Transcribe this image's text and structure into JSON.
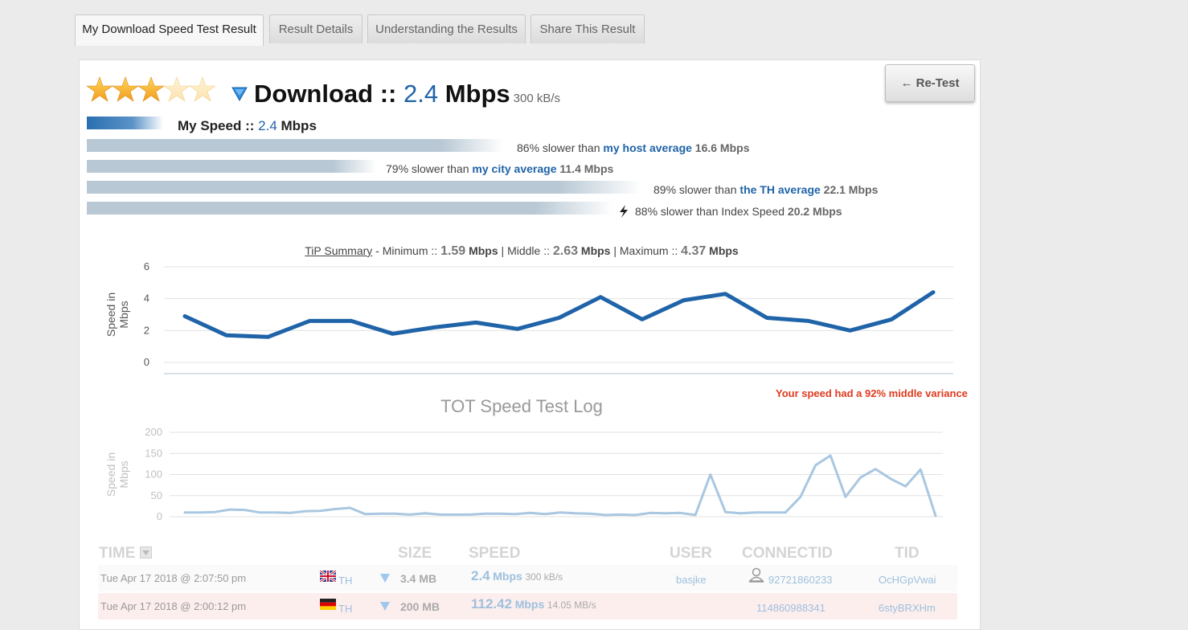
{
  "tabs": [
    {
      "label": "My Download Speed Test Result",
      "active": true
    },
    {
      "label": "Result Details"
    },
    {
      "label": "Understanding the Results"
    },
    {
      "label": "Share This Result"
    }
  ],
  "rating": {
    "stars": 3,
    "max": 5
  },
  "header": {
    "title": "Download ::",
    "speed": "2.4",
    "unit": "Mbps",
    "kbs": "300 kB/s",
    "retest_label": "← Re-Test"
  },
  "comparison": {
    "my_speed": {
      "prefix": "My Speed ::",
      "value": "2.4",
      "unit": "Mbps"
    },
    "rows": [
      {
        "pct_text": "86% slower than",
        "link": "my host average",
        "value": "16.6 Mbps",
        "fill": 0.86
      },
      {
        "pct_text": "79% slower than",
        "link": "my city average",
        "value": "11.4 Mbps",
        "fill": 0.79
      },
      {
        "pct_text": "89% slower than",
        "link": "the TH average",
        "value": "22.1 Mbps",
        "fill": 0.89
      },
      {
        "pct_text": "88% slower than Index Speed",
        "link": "",
        "value": "20.2 Mbps",
        "fill": 0.88
      }
    ]
  },
  "summary": {
    "tip": "TiP Summary",
    "minimum_label": "- Minimum ::",
    "minimum": "1.59",
    "middle_label": "| Middle ::",
    "middle": "2.63",
    "maximum_label": "| Maximum ::",
    "maximum": "4.37",
    "unit": "Mbps"
  },
  "variance_text": "Your speed had a 92% middle variance",
  "log_title": "TOT Speed Test Log",
  "chart_data": [
    {
      "type": "line",
      "ylabel": "Speed in Mbps",
      "ylim": [
        0,
        6
      ],
      "yticks": [
        0,
        2,
        4,
        6
      ],
      "color": "#1f63a8",
      "values": [
        2.9,
        1.7,
        1.6,
        2.6,
        2.6,
        1.8,
        2.2,
        2.5,
        2.1,
        2.8,
        4.1,
        2.7,
        3.9,
        4.3,
        2.8,
        2.6,
        2.0,
        2.7,
        4.4
      ]
    },
    {
      "type": "line",
      "ylabel": "Speed in Mbps",
      "ylim": [
        0,
        200
      ],
      "yticks": [
        0,
        50,
        100,
        150,
        200
      ],
      "color": "#a9c7e0",
      "values": [
        10,
        10,
        11,
        17,
        16,
        10,
        10,
        9,
        13,
        14,
        18,
        21,
        6,
        7,
        7,
        5,
        8,
        5,
        5,
        5,
        7,
        7,
        6,
        9,
        6,
        10,
        8,
        7,
        4,
        5,
        4,
        9,
        8,
        9,
        4,
        100,
        11,
        8,
        10,
        10,
        10,
        47,
        122,
        145,
        47,
        93,
        113,
        90,
        72,
        112,
        2
      ]
    }
  ],
  "table": {
    "headers": {
      "time": "TIME",
      "size": "SIZE",
      "speed": "SPEED",
      "user": "USER",
      "connectid": "CONNECTID",
      "tid": "TID"
    },
    "rows": [
      {
        "time": "Tue Apr 17 2018 @ 2:07:50 pm",
        "country": "TH",
        "size": "3.4 MB",
        "speed": "2.4",
        "speed_unit": "Mbps",
        "kbs": "300 kB/s",
        "user": "basjke",
        "connectid": "92721860233",
        "tid": "OcHGpVwai"
      },
      {
        "time": "Tue Apr 17 2018 @ 2:00:12 pm",
        "country": "TH",
        "size": "200 MB",
        "speed": "112.42",
        "speed_unit": "Mbps",
        "kbs": "14.05 MB/s",
        "user": "",
        "connectid": "114860988341",
        "tid": "6styBRXHm"
      }
    ]
  }
}
